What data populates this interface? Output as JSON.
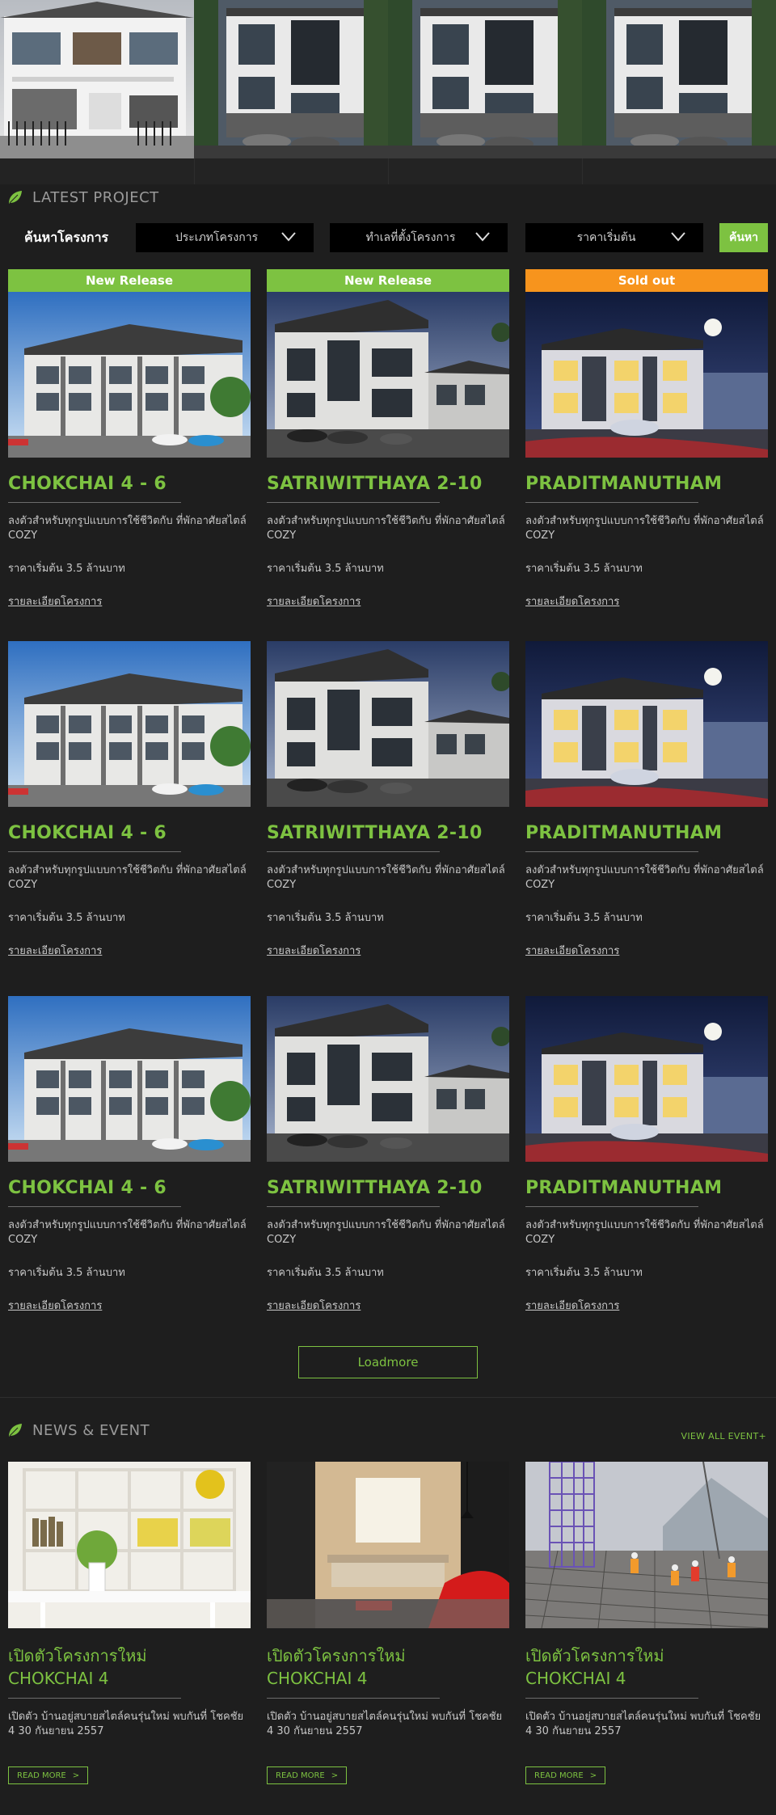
{
  "hero": {
    "images": [
      "house-photo-1",
      "house-photo-2",
      "house-photo-3",
      "house-photo-4"
    ]
  },
  "latest": {
    "title": "LATEST PROJECT",
    "search": {
      "label": "ค้นหาโครงการ",
      "type_select": "ประเภทโครงการ",
      "location_select": "ทำเลที่ตั้งโครงการ",
      "price_select": "ราคาเริ่มต้น",
      "button": "ค้นหา"
    },
    "projects": [
      {
        "badge": "New Release",
        "badge_color": "#7dc241",
        "name": "CHOKCHAI 4 - 6",
        "desc": "ลงตัวสำหรับทุกรูปแบบการใช้ชีวิตกับ ที่พักอาศัยสไตล์ COZY",
        "price": "ราคาเริ่มต้น 3.5 ล้านบาท",
        "link": "รายละเอียดโครงการ"
      },
      {
        "badge": "New Release",
        "badge_color": "#7dc241",
        "name": "SATRIWITTHAYA 2-10",
        "desc": "ลงตัวสำหรับทุกรูปแบบการใช้ชีวิตกับ ที่พักอาศัยสไตล์ COZY",
        "price": "ราคาเริ่มต้น 3.5 ล้านบาท",
        "link": "รายละเอียดโครงการ"
      },
      {
        "badge": "Sold out",
        "badge_color": "#f7941d",
        "name": "PRADITMANUTHAM",
        "desc": "ลงตัวสำหรับทุกรูปแบบการใช้ชีวิตกับ ที่พักอาศัยสไตล์ COZY",
        "price": "ราคาเริ่มต้น 3.5 ล้านบาท",
        "link": "รายละเอียดโครงการ"
      },
      {
        "badge": "",
        "name": "CHOKCHAI 4 - 6",
        "desc": "ลงตัวสำหรับทุกรูปแบบการใช้ชีวิตกับ ที่พักอาศัยสไตล์ COZY",
        "price": "ราคาเริ่มต้น 3.5 ล้านบาท",
        "link": "รายละเอียดโครงการ"
      },
      {
        "badge": "",
        "name": "SATRIWITTHAYA 2-10",
        "desc": "ลงตัวสำหรับทุกรูปแบบการใช้ชีวิตกับ ที่พักอาศัยสไตล์ COZY",
        "price": "ราคาเริ่มต้น 3.5 ล้านบาท",
        "link": "รายละเอียดโครงการ"
      },
      {
        "badge": "",
        "name": "PRADITMANUTHAM",
        "desc": "ลงตัวสำหรับทุกรูปแบบการใช้ชีวิตกับ ที่พักอาศัยสไตล์ COZY",
        "price": "ราคาเริ่มต้น 3.5 ล้านบาท",
        "link": "รายละเอียดโครงการ"
      },
      {
        "badge": "",
        "name": "CHOKCHAI 4 - 6",
        "desc": "ลงตัวสำหรับทุกรูปแบบการใช้ชีวิตกับ ที่พักอาศัยสไตล์ COZY",
        "price": "ราคาเริ่มต้น 3.5 ล้านบาท",
        "link": "รายละเอียดโครงการ"
      },
      {
        "badge": "",
        "name": "SATRIWITTHAYA 2-10",
        "desc": "ลงตัวสำหรับทุกรูปแบบการใช้ชีวิตกับ ที่พักอาศัยสไตล์ COZY",
        "price": "ราคาเริ่มต้น 3.5 ล้านบาท",
        "link": "รายละเอียดโครงการ"
      },
      {
        "badge": "",
        "name": "PRADITMANUTHAM",
        "desc": "ลงตัวสำหรับทุกรูปแบบการใช้ชีวิตกับ ที่พักอาศัยสไตล์ COZY",
        "price": "ราคาเริ่มต้น 3.5 ล้านบาท",
        "link": "รายละเอียดโครงการ"
      }
    ],
    "loadmore": "Loadmore"
  },
  "news": {
    "title": "NEWS & EVENT",
    "view_all": "VIEW ALL EVENT+",
    "items": [
      {
        "title_line1": "เปิดตัวโครงการใหม่",
        "title_line2": "CHOKCHAI 4",
        "desc": "เปิดตัว บ้านอยู่สบายสไตล์คนรุ่นใหม่ พบกันที่ โชคชัย 4 30 กันยายน 2557",
        "button": "READ MORE"
      },
      {
        "title_line1": "เปิดตัวโครงการใหม่",
        "title_line2": "CHOKCHAI 4",
        "desc": "เปิดตัว บ้านอยู่สบายสไตล์คนรุ่นใหม่ พบกันที่ โชคชัย 4 30 กันยายน 2557",
        "button": "READ MORE"
      },
      {
        "title_line1": "เปิดตัวโครงการใหม่",
        "title_line2": "CHOKCHAI 4",
        "desc": "เปิดตัว บ้านอยู่สบายสไตล์คนรุ่นใหม่ พบกันที่ โชคชัย 4 30 กันยายน 2557",
        "button": "READ MORE"
      }
    ]
  },
  "colors": {
    "accent": "#7dc241",
    "sold_out": "#f7941d",
    "background": "#1e1e1e"
  }
}
